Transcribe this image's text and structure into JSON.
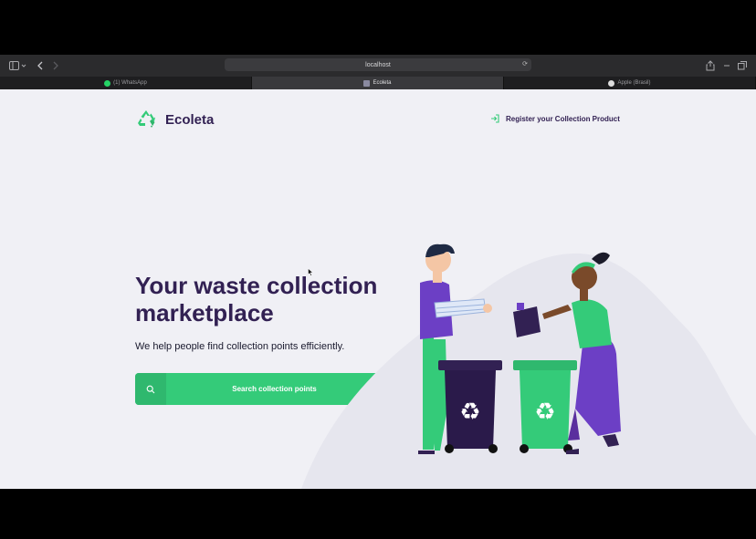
{
  "browser": {
    "url": "localhost",
    "tabs": [
      {
        "label": "(1) WhatsApp",
        "active": false
      },
      {
        "label": "Ecoleta",
        "active": true
      },
      {
        "label": "Apple (Brasil)",
        "active": false
      }
    ]
  },
  "header": {
    "brand": "Ecoleta",
    "register_link": "Register your Collection Product"
  },
  "hero": {
    "title_line1": "Your waste collection",
    "title_line2": "marketplace",
    "subtitle": "We help people find collection points efficiently.",
    "search_button": "Search collection points"
  },
  "colors": {
    "primary": "#34cb79",
    "title": "#322153",
    "background": "#f0f0f5"
  },
  "icons": [
    "sidebar-icon",
    "back-icon",
    "forward-icon",
    "share-icon",
    "tabs-icon",
    "recycle-logo-icon",
    "login-icon",
    "search-icon"
  ]
}
